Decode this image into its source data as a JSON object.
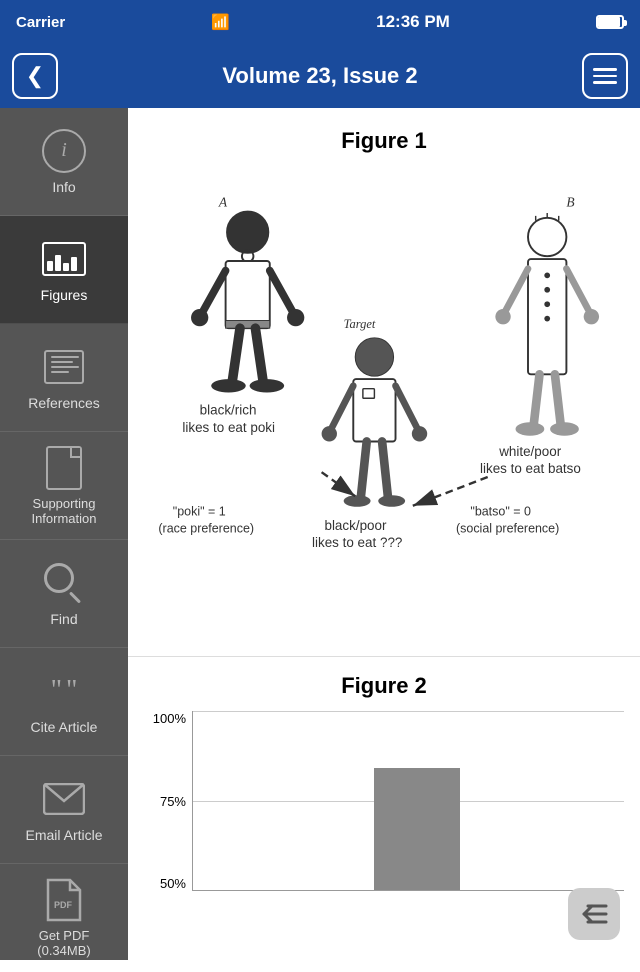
{
  "statusBar": {
    "carrier": "Carrier",
    "time": "12:36 PM"
  },
  "navBar": {
    "title": "Volume 23, Issue 2",
    "backLabel": "<",
    "menuLabel": "≡"
  },
  "sidebar": {
    "items": [
      {
        "id": "info",
        "label": "Info",
        "icon": "info-icon",
        "active": false
      },
      {
        "id": "figures",
        "label": "Figures",
        "icon": "figures-icon",
        "active": true
      },
      {
        "id": "references",
        "label": "References",
        "icon": "references-icon",
        "active": false
      },
      {
        "id": "supporting",
        "label": "Supporting\nInformation",
        "icon": "supporting-icon",
        "active": false
      },
      {
        "id": "find",
        "label": "Find",
        "icon": "find-icon",
        "active": false
      },
      {
        "id": "cite",
        "label": "Cite Article",
        "icon": "cite-icon",
        "active": false
      },
      {
        "id": "email",
        "label": "Email Article",
        "icon": "email-icon",
        "active": false
      },
      {
        "id": "pdf",
        "label": "Get PDF\n(0.34MB)",
        "icon": "pdf-icon",
        "active": false
      }
    ]
  },
  "content": {
    "figure1": {
      "title": "Figure 1",
      "personA": {
        "label": "A",
        "description1": "black/rich",
        "description2": "likes to eat poki"
      },
      "personTarget": {
        "label": "Target",
        "description1": "black/poor",
        "description2": "likes to eat ???"
      },
      "personB": {
        "label": "B",
        "description1": "white/poor",
        "description2": "likes to eat batso"
      },
      "annotation1": {
        "text1": "\"poki\" = 1",
        "text2": "(race preference)"
      },
      "annotation2": {
        "text1": "\"batso\" = 0",
        "text2": "(social preference)"
      }
    },
    "figure2": {
      "title": "Figure 2",
      "yAxis": {
        "labels": [
          "100%",
          "75%",
          "50%"
        ]
      },
      "bars": [
        {
          "id": "bar1",
          "heightPercent": 0
        },
        {
          "id": "bar2",
          "heightPercent": 68
        }
      ]
    }
  }
}
